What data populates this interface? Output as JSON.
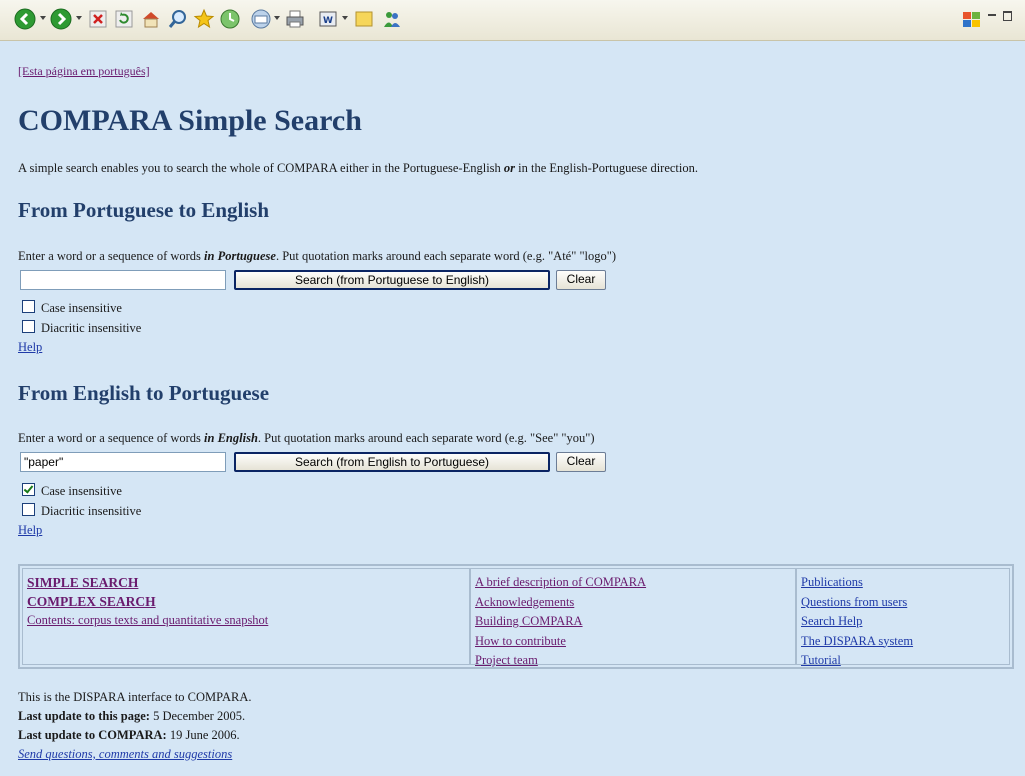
{
  "colors": {
    "background": "#d5e6f5",
    "heading": "#223f6b",
    "visited_link": "#6a1b6e",
    "link": "#1f3aa8"
  },
  "toolbar": {
    "icons": [
      "back-icon",
      "forward-icon",
      "stop-icon",
      "refresh-icon",
      "home-icon",
      "search-icon",
      "favorites-icon",
      "history-icon",
      "mail-icon",
      "print-icon",
      "edit-icon",
      "folder-icon",
      "messenger-icon"
    ]
  },
  "page": {
    "lang_link": "[Esta página em português]",
    "title": "COMPARA Simple Search",
    "intro": {
      "before": "A simple search enables you to search the whole of COMPARA either in the Portuguese-English ",
      "emph": "or",
      "after": " in the English-Portuguese direction."
    }
  },
  "pt_en": {
    "heading": "From Portuguese to English",
    "instr_before": "Enter a word or a sequence of words ",
    "instr_emph": "in Portuguese",
    "instr_after": ". Put quotation marks around each separate word (e.g. \"Até\" \"logo\")",
    "input_value": "",
    "search_label": "Search (from Portuguese to English)",
    "clear_label": "Clear",
    "case_label": "Case insensitive",
    "case_checked": false,
    "diacritic_label": "Diacritic insensitive",
    "diacritic_checked": false,
    "help": "Help"
  },
  "en_pt": {
    "heading": "From English to Portuguese",
    "instr_before": "Enter a word or a sequence of words ",
    "instr_emph": "in English",
    "instr_after": ". Put quotation marks around each separate word (e.g. \"See\" \"you\")",
    "input_value": "\"paper\"",
    "search_label": "Search (from English to Portuguese)",
    "clear_label": "Clear",
    "case_label": "Case insensitive",
    "case_checked": true,
    "diacritic_label": "Diacritic insensitive",
    "diacritic_checked": false,
    "help": "Help"
  },
  "nav": {
    "col1": [
      "SIMPLE SEARCH",
      "COMPLEX SEARCH",
      "Contents: corpus texts and quantitative snapshot"
    ],
    "col2": [
      "A brief description of COMPARA",
      "Acknowledgements",
      "Building COMPARA",
      "How to contribute",
      "Project team"
    ],
    "col3": [
      "Publications",
      "Questions from users",
      "Search Help",
      "The DISPARA system",
      "Tutorial"
    ]
  },
  "footer": {
    "line1": "This is the DISPARA interface to COMPARA.",
    "update_page_label": "Last update to this page:",
    "update_page_value": "5 December 2005.",
    "update_compara_label": "Last update to COMPARA:",
    "update_compara_value": "19 June 2006.",
    "contact": "Send questions, comments and suggestions"
  }
}
